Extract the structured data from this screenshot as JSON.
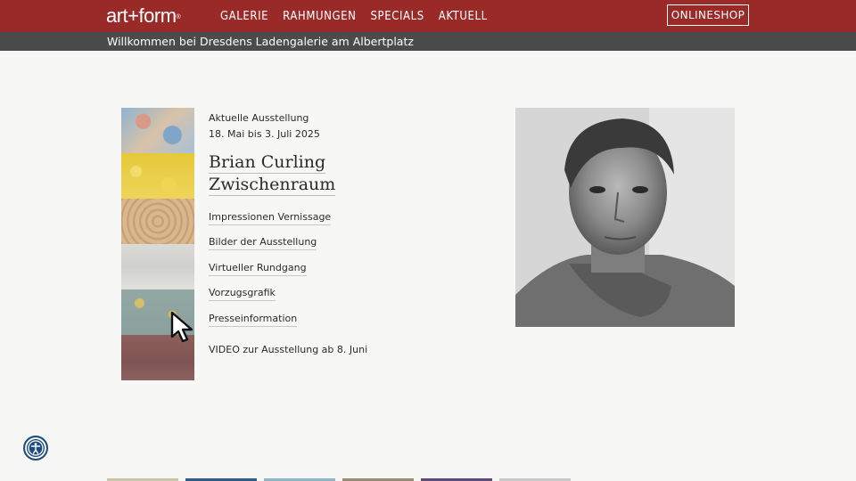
{
  "header": {
    "logo": "art+form",
    "logo_mark": "®",
    "nav": [
      {
        "label": "GALERIE"
      },
      {
        "label": "RAHMUNGEN"
      },
      {
        "label": "SPECIALS"
      },
      {
        "label": "AKTUELL"
      }
    ],
    "shop_label": "ONLINESHOP"
  },
  "subbar": {
    "welcome": "Willkommen bei Dresdens Ladengalerie am Albertplatz"
  },
  "exhibition": {
    "label": "Aktuelle Ausstellung",
    "dates": "18. Mai bis 3. Juli 2025",
    "artist": "Brian Curling",
    "title": "Zwischenraum",
    "links": [
      {
        "label": "Impressionen Vernissage"
      },
      {
        "label": "Bilder der Ausstellung"
      },
      {
        "label": "Virtueller Rundgang"
      },
      {
        "label": "Vorzugsgrafik"
      },
      {
        "label": "Presseinformation"
      }
    ],
    "video_note": "VIDEO zur Ausstellung ab 8. Juni"
  },
  "colors": {
    "brand_red": "#9a2a28",
    "subbar_gray": "#4b4b4b",
    "background": "#f7f7f6",
    "a11y_blue": "#1d4b7c"
  },
  "icons": {
    "accessibility": "accessibility-icon",
    "cursor": "mouse-pointer-icon"
  }
}
